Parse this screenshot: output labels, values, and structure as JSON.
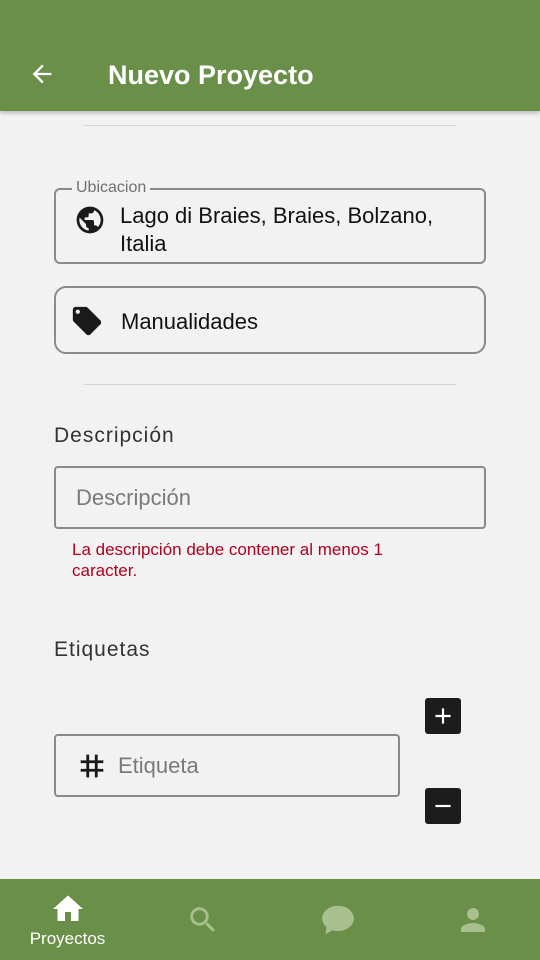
{
  "appbar": {
    "title": "Nuevo Proyecto",
    "back_icon": "arrow-back-icon"
  },
  "location": {
    "label": "Ubicacion",
    "value": "Lago di Braies, Braies, Bolzano, Italia",
    "icon": "globe-icon"
  },
  "category": {
    "value": "Manualidades",
    "icon": "tag-icon"
  },
  "description": {
    "section_title": "Descripción",
    "placeholder": "Descripción",
    "value": "",
    "error": "La descripción debe contener al menos 1 caracter."
  },
  "tags": {
    "section_title": "Etiquetas",
    "placeholder": "Etiqueta",
    "value": "",
    "icon": "hash-icon",
    "add_icon": "plus-icon",
    "remove_icon": "minus-icon"
  },
  "bottom_nav": {
    "items": [
      {
        "label": "Proyectos",
        "icon": "home-icon",
        "active": true
      },
      {
        "label": "",
        "icon": "search-icon",
        "active": false
      },
      {
        "label": "",
        "icon": "chat-icon",
        "active": false
      },
      {
        "label": "",
        "icon": "person-icon",
        "active": false
      }
    ],
    "active_color": "#ffffff",
    "inactive_color": "#a8c08e"
  },
  "colors": {
    "primary": "#6a8f48",
    "background": "#f2f2f2",
    "error": "#b00020"
  }
}
